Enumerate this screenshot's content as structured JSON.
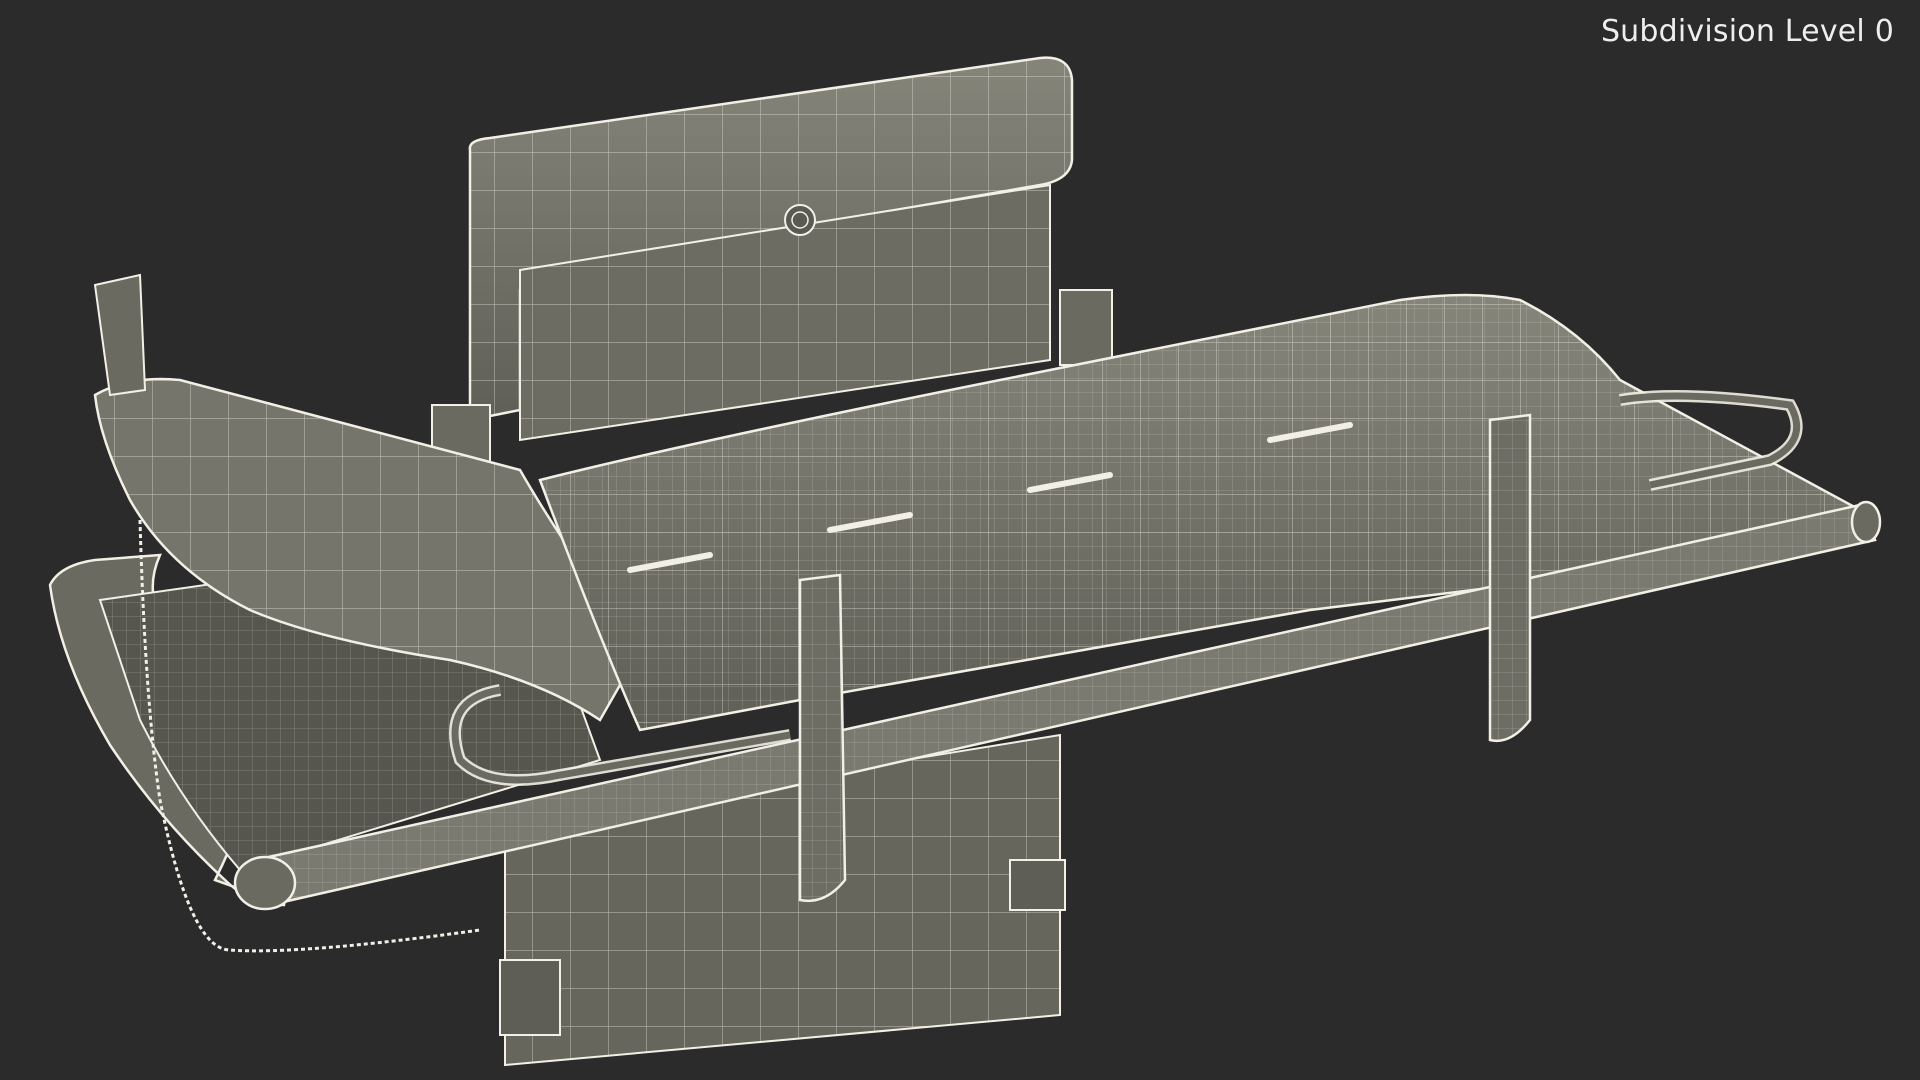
{
  "viewport": {
    "background": "#2b2b2b",
    "overlay_text": "Subdivision Level 0"
  },
  "model": {
    "subject": "wall-mounted baby changing station (open), wireframe render",
    "fill_color": "#6f6f66",
    "wire_color": "#f2f0e6"
  }
}
